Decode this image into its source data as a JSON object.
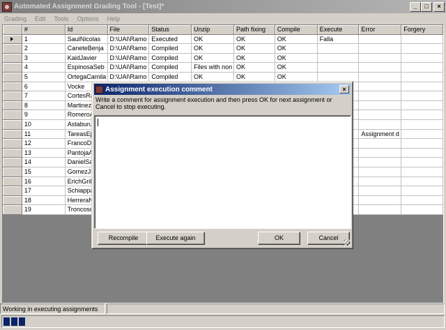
{
  "window": {
    "title": "Automated Assignment Grading Tool - [Test]*",
    "minimize": "_",
    "maximize": "□",
    "close": "×"
  },
  "menu": [
    "Grading",
    "Edit",
    "Tools",
    "Options",
    "Help"
  ],
  "grid": {
    "columns": [
      "#",
      "Id",
      "File",
      "Status",
      "Unzip",
      "Path fixing",
      "Compile",
      "Execute",
      "Error",
      "Forgery"
    ],
    "rows": [
      [
        "1",
        "SaulNicolas",
        "D:\\UAI\\Ramo",
        "Executed",
        "OK",
        "OK",
        "OK",
        "Falla",
        "",
        ""
      ],
      [
        "2",
        "CaneteBenja",
        "D:\\UAI\\Ramo",
        "Compiled",
        "OK",
        "OK",
        "OK",
        "",
        "",
        ""
      ],
      [
        "3",
        "KaidJavier",
        "D:\\UAI\\Ramo",
        "Compiled",
        "OK",
        "OK",
        "OK",
        "",
        "",
        ""
      ],
      [
        "4",
        "EspinosaSeb",
        "D:\\UAI\\Ramo",
        "Compiled",
        "Files with non",
        "OK",
        "OK",
        "",
        "",
        ""
      ],
      [
        "5",
        "OrtegaCamila",
        "D:\\UAI\\Ramo",
        "Compiled",
        "OK",
        "OK",
        "OK",
        "",
        "",
        ""
      ],
      [
        "6",
        "Vocke",
        "",
        "",
        "",
        "",
        "",
        "",
        "",
        ""
      ],
      [
        "7",
        "CortesRa",
        "",
        "",
        "",
        "",
        "",
        "",
        "",
        ""
      ],
      [
        "8",
        "MartinezF",
        "",
        "",
        "",
        "",
        "",
        "",
        "",
        ""
      ],
      [
        "9",
        "RomeroAl",
        "",
        "",
        "",
        "",
        "",
        "",
        "",
        ""
      ],
      [
        "10",
        "Astaburua",
        "",
        "",
        "",
        "",
        "",
        "",
        "",
        ""
      ],
      [
        "11",
        "TareasEje",
        "",
        "",
        "",
        "",
        "",
        "",
        "Assignment d",
        ""
      ],
      [
        "12",
        "FrancoDie",
        "",
        "",
        "",
        "",
        "",
        "",
        "",
        ""
      ],
      [
        "13",
        "PantojaAl",
        "",
        "",
        "",
        "",
        "",
        "",
        "",
        ""
      ],
      [
        "14",
        "DanielSar",
        "",
        "",
        "",
        "",
        "",
        "",
        "",
        ""
      ],
      [
        "15",
        "GomezJu",
        "",
        "",
        "",
        "",
        "",
        "",
        "",
        ""
      ],
      [
        "16",
        "ErichGrill",
        "",
        "",
        "",
        "",
        "",
        "",
        "",
        ""
      ],
      [
        "17",
        "Schiappa",
        "",
        "",
        "",
        "",
        "",
        "",
        "",
        ""
      ],
      [
        "18",
        "HerreraNi",
        "",
        "",
        "",
        "",
        "",
        "",
        "",
        ""
      ],
      [
        "19",
        "Troncoso",
        "",
        "",
        "",
        "",
        "",
        "",
        "",
        ""
      ]
    ]
  },
  "status": {
    "message": "Working in executing assignments",
    "panel2": "",
    "progress_blocks": 3
  },
  "dialog": {
    "title": "Assignment execution comment",
    "close": "×",
    "message": "Write a comment for assignment execution and then press OK for next assignment or\nCancel to stop executing.",
    "comment_value": "",
    "buttons": {
      "recompile": "Recompile",
      "execute_again": "Execute again",
      "ok": "OK",
      "cancel": "Cancel"
    }
  }
}
